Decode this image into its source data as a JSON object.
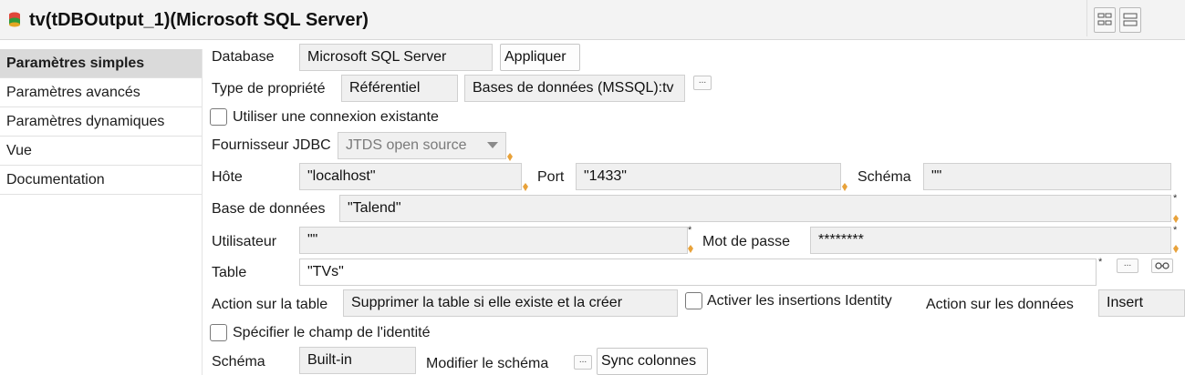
{
  "header": {
    "title": "tv(tDBOutput_1)(Microsoft SQL Server)"
  },
  "sidebar": {
    "items": [
      {
        "label": "Paramètres simples"
      },
      {
        "label": "Paramètres avancés"
      },
      {
        "label": "Paramètres dynamiques"
      },
      {
        "label": "Vue"
      },
      {
        "label": "Documentation"
      }
    ]
  },
  "form": {
    "database": {
      "label": "Database",
      "value": "Microsoft SQL Server",
      "apply_label": "Appliquer"
    },
    "property_type": {
      "label": "Type de propriété",
      "value": "Référentiel",
      "repository": "Bases de données (MSSQL):tv",
      "browse": "..."
    },
    "use_existing": {
      "label": "Utiliser une connexion existante",
      "checked": false
    },
    "jdbc_provider": {
      "label": "Fournisseur JDBC",
      "value": "JTDS open source"
    },
    "host": {
      "label": "Hôte",
      "value": "\"localhost\""
    },
    "port": {
      "label": "Port",
      "value": "\"1433\""
    },
    "schema_db": {
      "label": "Schéma",
      "value": "\"\""
    },
    "dbname": {
      "label": "Base de données",
      "value": "\"Talend\""
    },
    "user": {
      "label": "Utilisateur",
      "value": "\"\""
    },
    "password": {
      "label": "Mot de passe",
      "value": "********"
    },
    "table": {
      "label": "Table",
      "value": "\"TVs\"",
      "browse": "..."
    },
    "table_action": {
      "label": "Action sur la table",
      "value": "Supprimer la table si elle existe et la créer"
    },
    "identity_insert": {
      "label": "Activer les insertions Identity",
      "checked": false
    },
    "data_action": {
      "label": "Action sur les données",
      "value": "Insert"
    },
    "identity_field": {
      "label": "Spécifier le champ de l'identité",
      "checked": false
    },
    "schema": {
      "label": "Schéma",
      "value": "Built-in",
      "edit_label": "Modifier le schéma",
      "edit_button": "...",
      "sync_label": "Sync colonnes"
    }
  },
  "required_mark": "*",
  "colors": {
    "sidebar_active": "#dadada",
    "field_bg": "#f0f0f0",
    "warn": "#e8a23a"
  }
}
